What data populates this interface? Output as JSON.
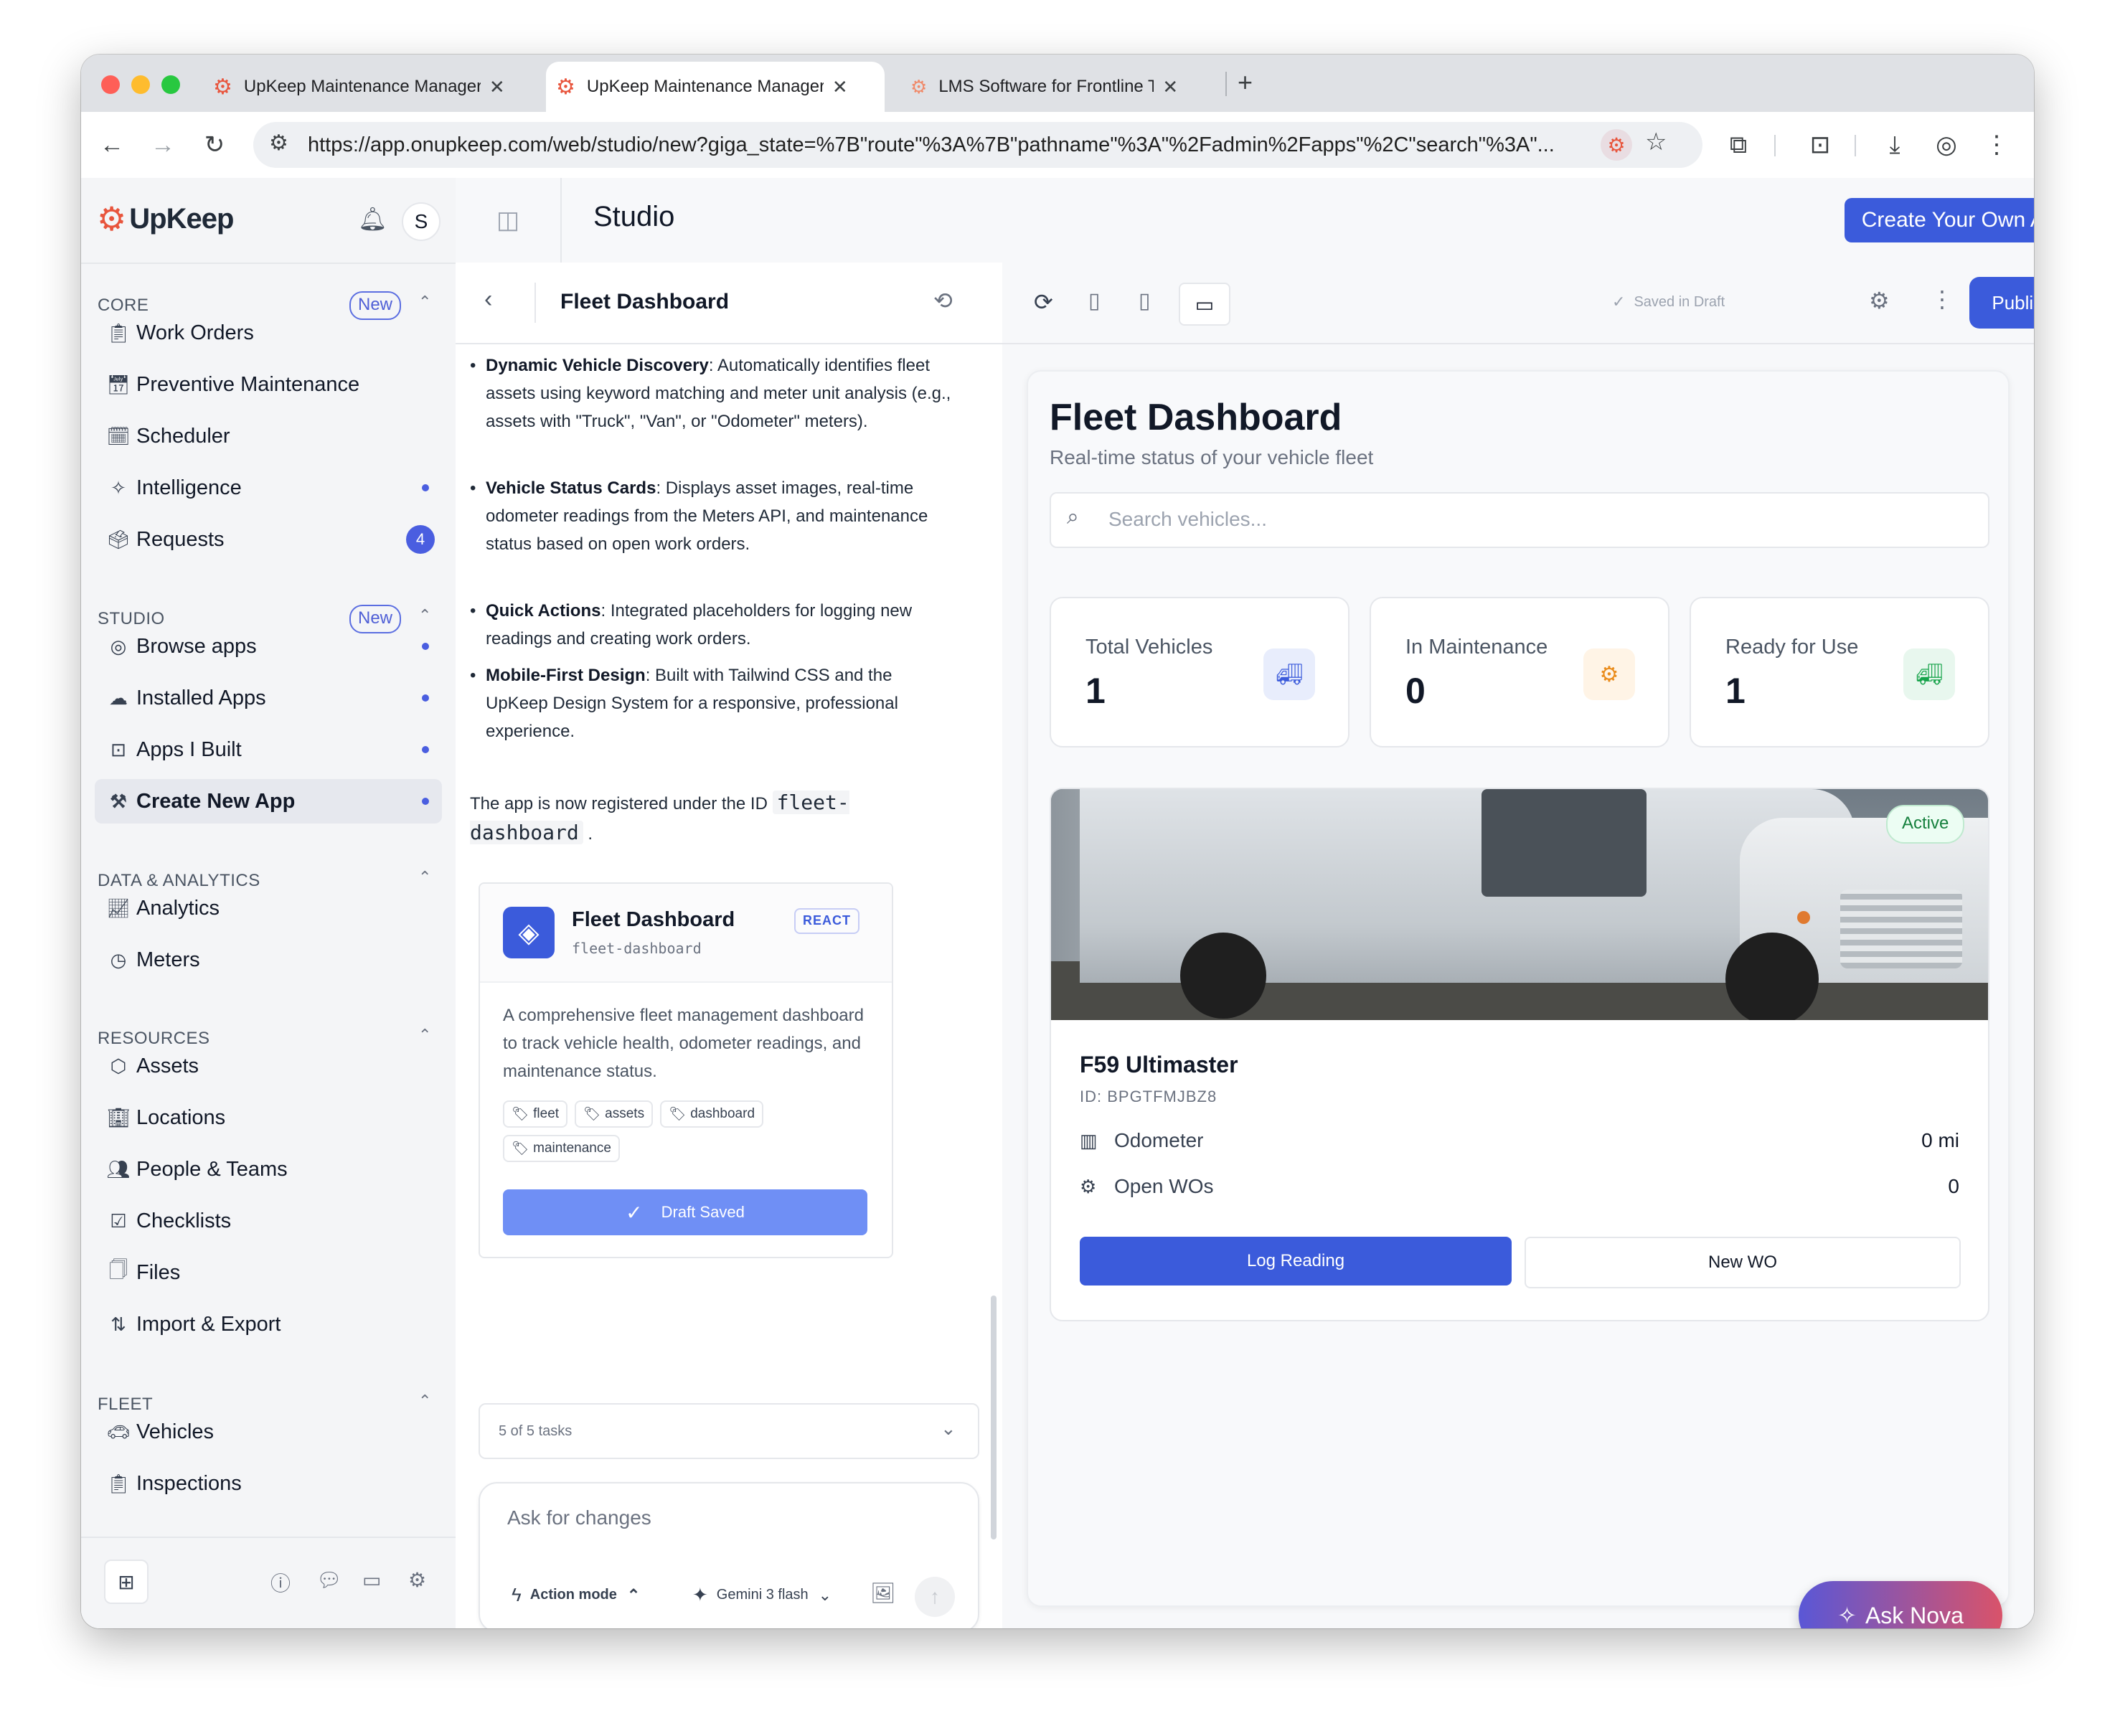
{
  "browser": {
    "tabs": [
      {
        "title": "UpKeep Maintenance Manager"
      },
      {
        "title": "UpKeep Maintenance Manager"
      },
      {
        "title": "LMS Software for Frontline Teams"
      }
    ],
    "url": "https://app.onupkeep.com/web/studio/new?giga_state=%7B\"route\"%3A%7B\"pathname\"%3A\"%2Fadmin%2Fapps\"%2C\"search\"%3A\"..."
  },
  "sidebar": {
    "brand": "UpKeep",
    "avatar": "S",
    "new_pill": "New",
    "sections": {
      "core": "CORE",
      "studio": "STUDIO",
      "data": "DATA & ANALYTICS",
      "resources": "RESOURCES",
      "fleet": "FLEET"
    },
    "core_items": [
      "Work Orders",
      "Preventive Maintenance",
      "Scheduler",
      "Intelligence",
      "Requests"
    ],
    "requests_count": "4",
    "studio_items": [
      "Browse apps",
      "Installed Apps",
      "Apps I Built",
      "Create New App"
    ],
    "data_items": [
      "Analytics",
      "Meters"
    ],
    "resources_items": [
      "Assets",
      "Locations",
      "People & Teams",
      "Checklists",
      "Files",
      "Import & Export"
    ],
    "fleet_items": [
      "Vehicles",
      "Inspections"
    ]
  },
  "header": {
    "title": "Studio",
    "cta": "Create Your Own App"
  },
  "chat": {
    "title": "Fleet Dashboard",
    "bullets": [
      {
        "bold": "Dynamic Vehicle Discovery",
        "text": ": Automatically identifies fleet assets using keyword matching and meter unit analysis (e.g., assets with \"Truck\", \"Van\", or \"Odometer\" meters)."
      },
      {
        "bold": "Vehicle Status Cards",
        "text": ": Displays asset images, real-time odometer readings from the Meters API, and maintenance status based on open work orders."
      },
      {
        "bold": "Quick Actions",
        "text": ": Integrated placeholders for logging new readings and creating work orders."
      },
      {
        "bold": "Mobile-First Design",
        "text": ": Built with Tailwind CSS and the UpKeep Design System for a responsive, professional experience."
      }
    ],
    "registered_text": "The app is now registered under the ID",
    "app_id": "fleet-dashboard",
    "app_card": {
      "name": "Fleet Dashboard",
      "slug": "fleet-dashboard",
      "framework": "REACT",
      "description": "A comprehensive fleet management dashboard to track vehicle health, odometer readings, and maintenance status.",
      "tags": [
        "fleet",
        "assets",
        "dashboard",
        "maintenance"
      ],
      "status_button": "Draft Saved"
    },
    "tasks": "5 of 5 tasks",
    "input_placeholder": "Ask for changes",
    "mode": "Action mode",
    "model": "Gemini 3 flash"
  },
  "preview_toolbar": {
    "saved": "Saved in Draft",
    "publish": "Publish"
  },
  "dashboard": {
    "title": "Fleet Dashboard",
    "subtitle": "Real-time status of your vehicle fleet",
    "search_placeholder": "Search vehicles...",
    "stats": [
      {
        "label": "Total Vehicles",
        "value": "1"
      },
      {
        "label": "In Maintenance",
        "value": "0"
      },
      {
        "label": "Ready for Use",
        "value": "1"
      }
    ],
    "vehicle": {
      "status": "Active",
      "name": "F59 Ultimaster",
      "id": "ID: BPGTFMJBZ8",
      "odometer_label": "Odometer",
      "odometer_value": "0 mi",
      "open_wos_label": "Open WOs",
      "open_wos_value": "0",
      "log_button": "Log Reading",
      "new_wo_button": "New WO"
    }
  },
  "nova": {
    "label": "Ask Nova"
  },
  "colors": {
    "primary": "#3b5bdb",
    "brand": "#e8553d",
    "active_green": "#15803d",
    "draft_saved": "#6f8ff5"
  }
}
